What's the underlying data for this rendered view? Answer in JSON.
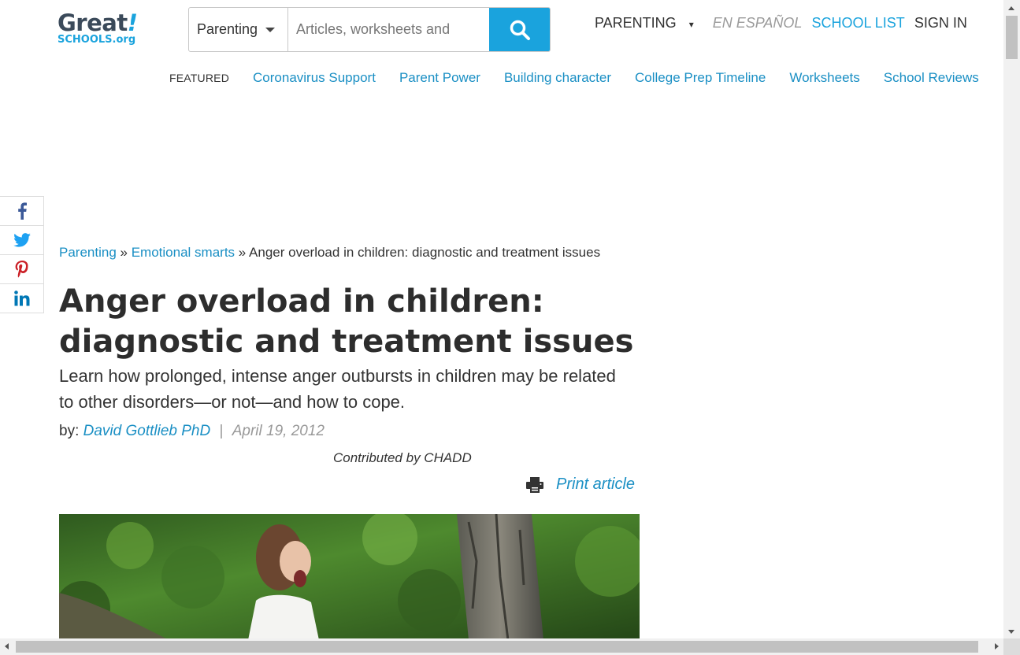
{
  "logo": {
    "great": "Great",
    "excl": "!",
    "schools": "SCHOOLS.org"
  },
  "search": {
    "category": "Parenting",
    "placeholder": "Articles, worksheets and"
  },
  "topnav": {
    "parenting": "PARENTING",
    "parenting_caret": "▾",
    "espanol": "EN ESPAÑOL",
    "school_list": "SCHOOL LIST",
    "sign_in": "SIGN IN"
  },
  "featured": {
    "label": "FEATURED",
    "links": [
      "Coronavirus Support",
      "Parent Power",
      "Building character",
      "College Prep Timeline",
      "Worksheets",
      "School Reviews"
    ]
  },
  "social": [
    "facebook-icon",
    "twitter-icon",
    "pinterest-icon",
    "linkedin-icon"
  ],
  "breadcrumb": {
    "item1": "Parenting",
    "sep": "»",
    "item2": "Emotional smarts",
    "current": "Anger overload in children: diagnostic and treatment issues"
  },
  "article": {
    "title": "Anger overload in children: diagnostic and treatment issues",
    "subtitle": "Learn how prolonged, intense anger outbursts in children may be related to other disorders—or not—and how to cope.",
    "by_label": "by:",
    "author": "David Gottlieb PhD",
    "separator": "|",
    "date": "April 19, 2012",
    "contributed": "Contributed by CHADD",
    "print_label": "Print article"
  },
  "colors": {
    "brand_blue": "#1aa3dd",
    "link_blue": "#1a8fc4",
    "logo_dark": "#3b4a5a"
  }
}
